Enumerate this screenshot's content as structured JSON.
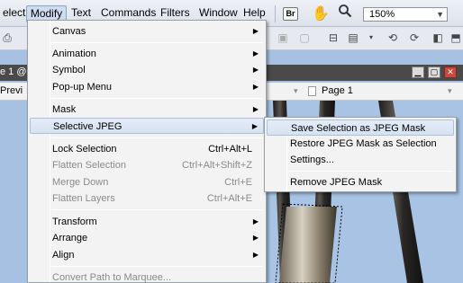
{
  "menubar": {
    "items": [
      "elect",
      "Modify",
      "Text",
      "Commands",
      "Filters",
      "Window",
      "Help"
    ],
    "zoom": "150%"
  },
  "document": {
    "title": "e 1 @ 1",
    "preview_tab": "Previ",
    "page_label": "Page 1"
  },
  "modify_menu": [
    {
      "label": "Canvas",
      "shortcut": "",
      "submenu": true,
      "disabled": false
    },
    {
      "label": "Animation",
      "shortcut": "",
      "submenu": true,
      "disabled": false
    },
    {
      "label": "Symbol",
      "shortcut": "",
      "submenu": true,
      "disabled": false
    },
    {
      "label": "Pop-up Menu",
      "shortcut": "",
      "submenu": true,
      "disabled": false
    },
    {
      "label": "Mask",
      "shortcut": "",
      "submenu": true,
      "disabled": false
    },
    {
      "label": "Selective JPEG",
      "shortcut": "",
      "submenu": true,
      "disabled": false,
      "highlighted": true
    },
    {
      "label": "Lock Selection",
      "shortcut": "Ctrl+Alt+L",
      "submenu": false,
      "disabled": false
    },
    {
      "label": "Flatten Selection",
      "shortcut": "Ctrl+Alt+Shift+Z",
      "submenu": false,
      "disabled": true
    },
    {
      "label": "Merge Down",
      "shortcut": "Ctrl+E",
      "submenu": false,
      "disabled": true
    },
    {
      "label": "Flatten Layers",
      "shortcut": "Ctrl+Alt+E",
      "submenu": false,
      "disabled": true
    },
    {
      "label": "Transform",
      "shortcut": "",
      "submenu": true,
      "disabled": false
    },
    {
      "label": "Arrange",
      "shortcut": "",
      "submenu": true,
      "disabled": false
    },
    {
      "label": "Align",
      "shortcut": "",
      "submenu": true,
      "disabled": false
    },
    {
      "label": "Convert Path to Marquee...",
      "shortcut": "",
      "submenu": false,
      "disabled": true
    }
  ],
  "selective_jpeg_menu": [
    {
      "label": "Save Selection as JPEG Mask",
      "highlighted": true
    },
    {
      "label": "Restore JPEG Mask as Selection"
    },
    {
      "label": "Settings..."
    },
    {
      "label": "Remove JPEG Mask"
    }
  ],
  "icons": {
    "bridge": "Br",
    "hand": "✋",
    "zoom": "🔍"
  }
}
